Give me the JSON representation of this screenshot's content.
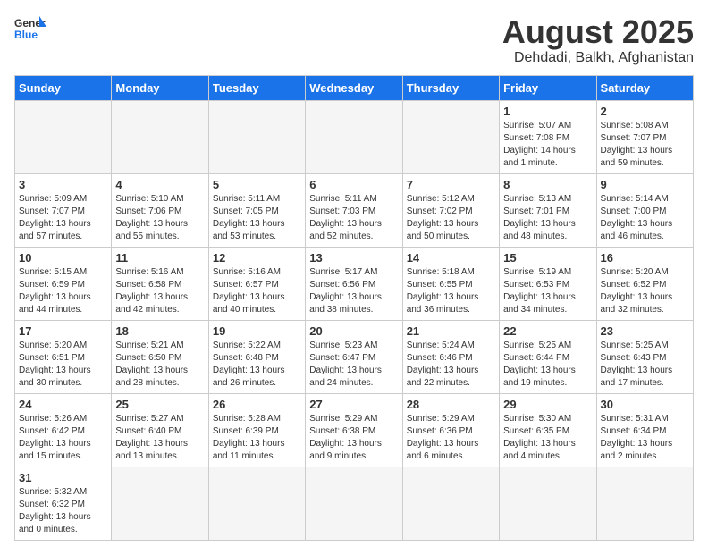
{
  "header": {
    "logo_general": "General",
    "logo_blue": "Blue",
    "title": "August 2025",
    "subtitle": "Dehdadi, Balkh, Afghanistan"
  },
  "weekdays": [
    "Sunday",
    "Monday",
    "Tuesday",
    "Wednesday",
    "Thursday",
    "Friday",
    "Saturday"
  ],
  "weeks": [
    [
      {
        "day": "",
        "info": ""
      },
      {
        "day": "",
        "info": ""
      },
      {
        "day": "",
        "info": ""
      },
      {
        "day": "",
        "info": ""
      },
      {
        "day": "",
        "info": ""
      },
      {
        "day": "1",
        "info": "Sunrise: 5:07 AM\nSunset: 7:08 PM\nDaylight: 14 hours\nand 1 minute."
      },
      {
        "day": "2",
        "info": "Sunrise: 5:08 AM\nSunset: 7:07 PM\nDaylight: 13 hours\nand 59 minutes."
      }
    ],
    [
      {
        "day": "3",
        "info": "Sunrise: 5:09 AM\nSunset: 7:07 PM\nDaylight: 13 hours\nand 57 minutes."
      },
      {
        "day": "4",
        "info": "Sunrise: 5:10 AM\nSunset: 7:06 PM\nDaylight: 13 hours\nand 55 minutes."
      },
      {
        "day": "5",
        "info": "Sunrise: 5:11 AM\nSunset: 7:05 PM\nDaylight: 13 hours\nand 53 minutes."
      },
      {
        "day": "6",
        "info": "Sunrise: 5:11 AM\nSunset: 7:03 PM\nDaylight: 13 hours\nand 52 minutes."
      },
      {
        "day": "7",
        "info": "Sunrise: 5:12 AM\nSunset: 7:02 PM\nDaylight: 13 hours\nand 50 minutes."
      },
      {
        "day": "8",
        "info": "Sunrise: 5:13 AM\nSunset: 7:01 PM\nDaylight: 13 hours\nand 48 minutes."
      },
      {
        "day": "9",
        "info": "Sunrise: 5:14 AM\nSunset: 7:00 PM\nDaylight: 13 hours\nand 46 minutes."
      }
    ],
    [
      {
        "day": "10",
        "info": "Sunrise: 5:15 AM\nSunset: 6:59 PM\nDaylight: 13 hours\nand 44 minutes."
      },
      {
        "day": "11",
        "info": "Sunrise: 5:16 AM\nSunset: 6:58 PM\nDaylight: 13 hours\nand 42 minutes."
      },
      {
        "day": "12",
        "info": "Sunrise: 5:16 AM\nSunset: 6:57 PM\nDaylight: 13 hours\nand 40 minutes."
      },
      {
        "day": "13",
        "info": "Sunrise: 5:17 AM\nSunset: 6:56 PM\nDaylight: 13 hours\nand 38 minutes."
      },
      {
        "day": "14",
        "info": "Sunrise: 5:18 AM\nSunset: 6:55 PM\nDaylight: 13 hours\nand 36 minutes."
      },
      {
        "day": "15",
        "info": "Sunrise: 5:19 AM\nSunset: 6:53 PM\nDaylight: 13 hours\nand 34 minutes."
      },
      {
        "day": "16",
        "info": "Sunrise: 5:20 AM\nSunset: 6:52 PM\nDaylight: 13 hours\nand 32 minutes."
      }
    ],
    [
      {
        "day": "17",
        "info": "Sunrise: 5:20 AM\nSunset: 6:51 PM\nDaylight: 13 hours\nand 30 minutes."
      },
      {
        "day": "18",
        "info": "Sunrise: 5:21 AM\nSunset: 6:50 PM\nDaylight: 13 hours\nand 28 minutes."
      },
      {
        "day": "19",
        "info": "Sunrise: 5:22 AM\nSunset: 6:48 PM\nDaylight: 13 hours\nand 26 minutes."
      },
      {
        "day": "20",
        "info": "Sunrise: 5:23 AM\nSunset: 6:47 PM\nDaylight: 13 hours\nand 24 minutes."
      },
      {
        "day": "21",
        "info": "Sunrise: 5:24 AM\nSunset: 6:46 PM\nDaylight: 13 hours\nand 22 minutes."
      },
      {
        "day": "22",
        "info": "Sunrise: 5:25 AM\nSunset: 6:44 PM\nDaylight: 13 hours\nand 19 minutes."
      },
      {
        "day": "23",
        "info": "Sunrise: 5:25 AM\nSunset: 6:43 PM\nDaylight: 13 hours\nand 17 minutes."
      }
    ],
    [
      {
        "day": "24",
        "info": "Sunrise: 5:26 AM\nSunset: 6:42 PM\nDaylight: 13 hours\nand 15 minutes."
      },
      {
        "day": "25",
        "info": "Sunrise: 5:27 AM\nSunset: 6:40 PM\nDaylight: 13 hours\nand 13 minutes."
      },
      {
        "day": "26",
        "info": "Sunrise: 5:28 AM\nSunset: 6:39 PM\nDaylight: 13 hours\nand 11 minutes."
      },
      {
        "day": "27",
        "info": "Sunrise: 5:29 AM\nSunset: 6:38 PM\nDaylight: 13 hours\nand 9 minutes."
      },
      {
        "day": "28",
        "info": "Sunrise: 5:29 AM\nSunset: 6:36 PM\nDaylight: 13 hours\nand 6 minutes."
      },
      {
        "day": "29",
        "info": "Sunrise: 5:30 AM\nSunset: 6:35 PM\nDaylight: 13 hours\nand 4 minutes."
      },
      {
        "day": "30",
        "info": "Sunrise: 5:31 AM\nSunset: 6:34 PM\nDaylight: 13 hours\nand 2 minutes."
      }
    ],
    [
      {
        "day": "31",
        "info": "Sunrise: 5:32 AM\nSunset: 6:32 PM\nDaylight: 13 hours\nand 0 minutes."
      },
      {
        "day": "",
        "info": ""
      },
      {
        "day": "",
        "info": ""
      },
      {
        "day": "",
        "info": ""
      },
      {
        "day": "",
        "info": ""
      },
      {
        "day": "",
        "info": ""
      },
      {
        "day": "",
        "info": ""
      }
    ]
  ]
}
